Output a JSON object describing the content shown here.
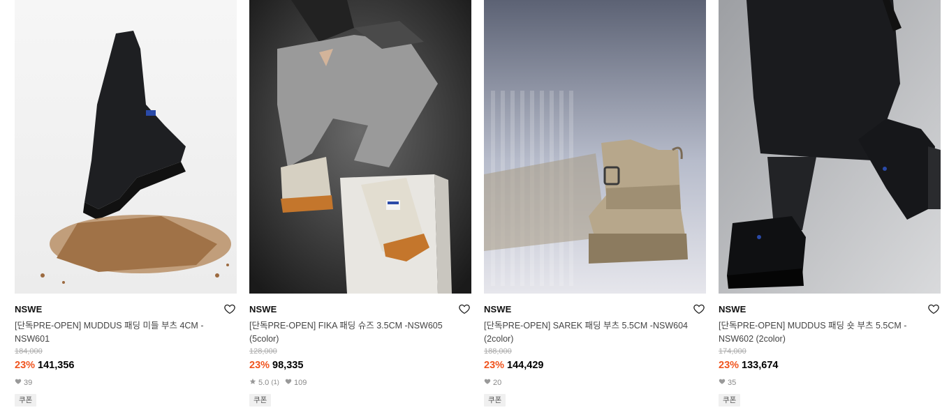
{
  "products": [
    {
      "brand": "NSWE",
      "name": "[단독PRE-OPEN] MUDDUS 패딩 미들 부츠 4CM -NSW601",
      "original_price": "184,000",
      "discount": "23%",
      "price": "141,356",
      "rating": "",
      "review_count": "",
      "likes": "39",
      "badge": "쿠폰"
    },
    {
      "brand": "NSWE",
      "name": "[단독PRE-OPEN] FIKA 패딩 슈즈 3.5CM -NSW605 (5color)",
      "original_price": "128,000",
      "discount": "23%",
      "price": "98,335",
      "rating": "5.0",
      "review_count": "(1)",
      "likes": "109",
      "badge": "쿠폰"
    },
    {
      "brand": "NSWE",
      "name": "[단독PRE-OPEN] SAREK 패딩 부츠 5.5CM -NSW604 (2color)",
      "original_price": "188,000",
      "discount": "23%",
      "price": "144,429",
      "rating": "",
      "review_count": "",
      "likes": "20",
      "badge": "쿠폰"
    },
    {
      "brand": "NSWE",
      "name": "[단독PRE-OPEN] MUDDUS 패딩 숏 부츠 5.5CM -NSW602 (2color)",
      "original_price": "174,000",
      "discount": "23%",
      "price": "133,674",
      "rating": "",
      "review_count": "",
      "likes": "35",
      "badge": "쿠폰"
    }
  ],
  "colors": {
    "discount": "#f0541e",
    "meta": "#888888",
    "badge_bg": "#f0f0f0"
  }
}
